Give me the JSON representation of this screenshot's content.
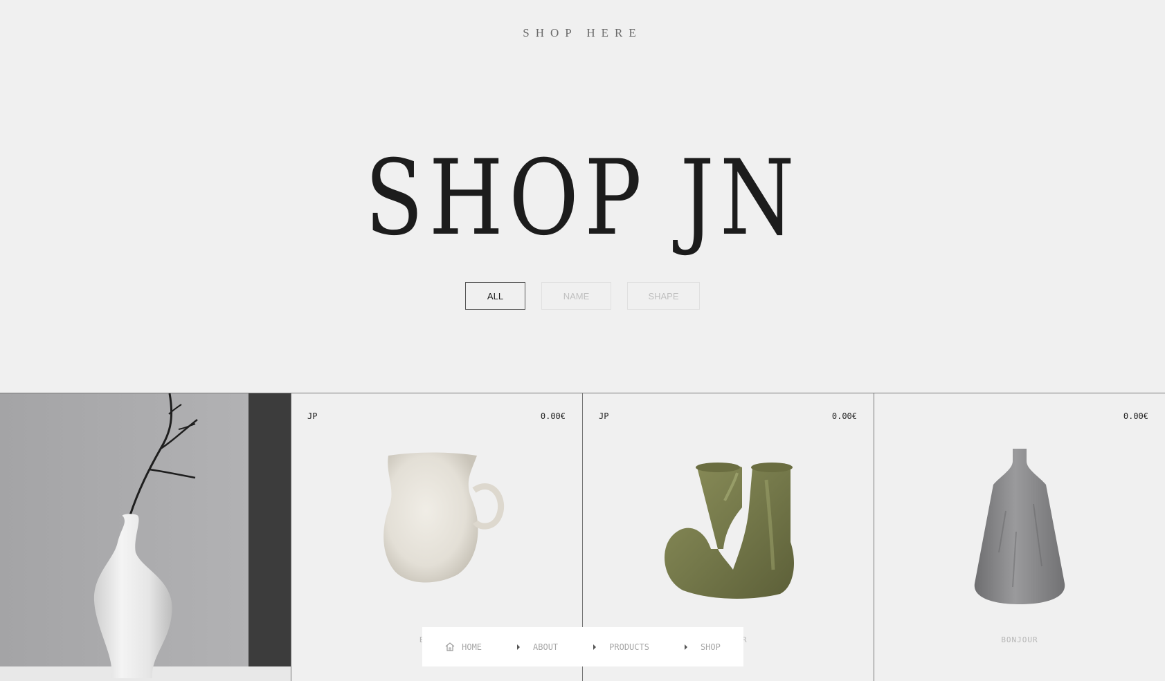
{
  "header": {
    "tagline": "SHOP HERE",
    "title": "SHOP JN"
  },
  "filters": [
    {
      "label": "ALL",
      "active": true
    },
    {
      "label": "NAME",
      "active": false
    },
    {
      "label": "SHAPE",
      "active": false
    }
  ],
  "products": [
    {
      "brand": "JP",
      "price": "0.00€",
      "name": "B",
      "icon": "cream-mug-image"
    },
    {
      "brand": "JP",
      "price": "0.00€",
      "name": "R",
      "icon": "green-double-vase-image"
    },
    {
      "brand": "",
      "price": "0.00€",
      "name": "BONJOUR",
      "icon": "grey-bottle-vase-image"
    }
  ],
  "feature_image": {
    "icon": "white-vase-with-branch-image"
  },
  "nav": {
    "items": [
      {
        "label": "HOME",
        "icon": "home-icon"
      },
      {
        "label": "ABOUT",
        "icon": "caret-right-icon"
      },
      {
        "label": "PRODUCTS",
        "icon": "caret-right-icon"
      },
      {
        "label": "SHOP",
        "icon": "caret-right-icon"
      }
    ]
  },
  "colors": {
    "background": "#f0f0f0",
    "text": "#1a1a1a",
    "muted": "#c0c0c0",
    "mug": "#e4e0d8",
    "green_vase": "#7a7d4a",
    "grey_vase": "#8a8a8c"
  }
}
